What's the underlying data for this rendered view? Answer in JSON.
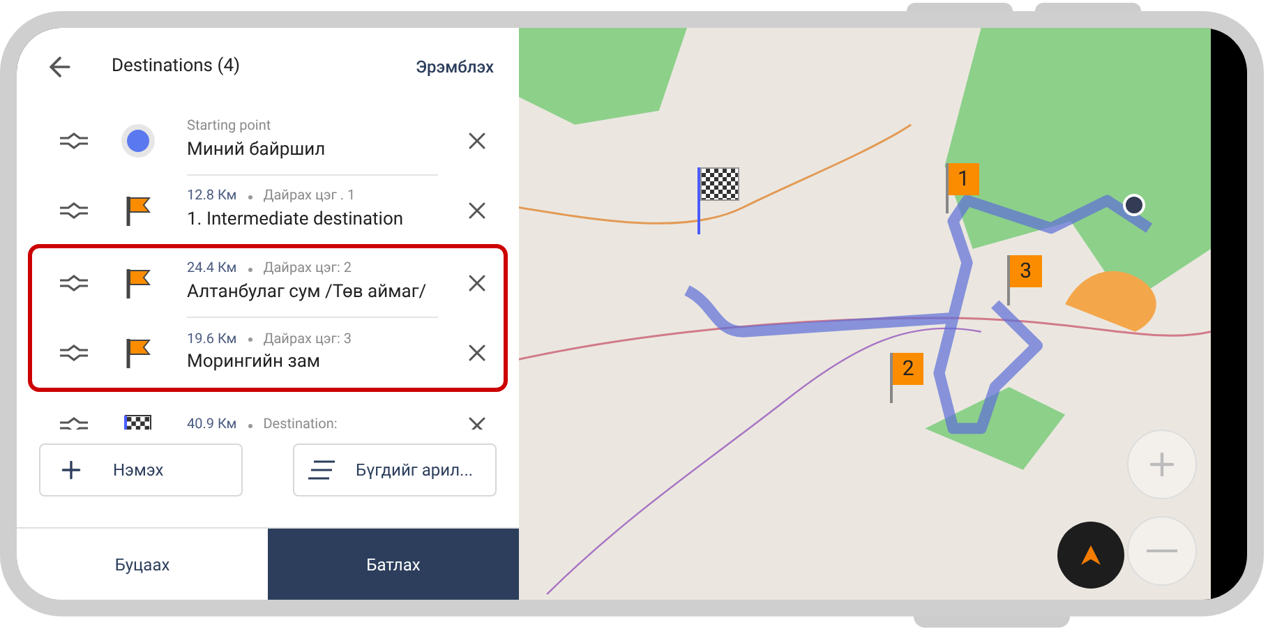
{
  "header": {
    "title": "Destinations (4)",
    "action": "Эрэмблэх"
  },
  "destinations": [
    {
      "kind": "start",
      "caption": "Starting point",
      "name": "Миний байршил",
      "highlighted": false
    },
    {
      "kind": "waypoint",
      "distance": "12.8 Км",
      "caption": "Дайрах цэг . 1",
      "name": "1. Intermediate destination",
      "highlighted": false
    },
    {
      "kind": "waypoint",
      "distance": "24.4 Км",
      "caption": "Дайрах цэг: 2",
      "name": "Алтанбулаг сум /Төв аймаг/",
      "highlighted": true
    },
    {
      "kind": "waypoint",
      "distance": "19.6 Км",
      "caption": "Дайрах цэг: 3",
      "name": "Морингийн зам",
      "highlighted": true
    },
    {
      "kind": "finish",
      "distance": "40.9 Км",
      "caption": "Destination:",
      "highlighted": false
    }
  ],
  "actions": [
    "Нэмэх",
    "Бүгдийг арил..."
  ],
  "footer": {
    "cancel": "Буцаах",
    "confirm": "Батлах"
  },
  "map": {
    "markers": [
      {
        "kind": "finish"
      },
      {
        "kind": "waypoint",
        "label": "1"
      },
      {
        "kind": "waypoint",
        "label": "2"
      },
      {
        "kind": "waypoint",
        "label": "3"
      },
      {
        "kind": "start"
      }
    ]
  }
}
